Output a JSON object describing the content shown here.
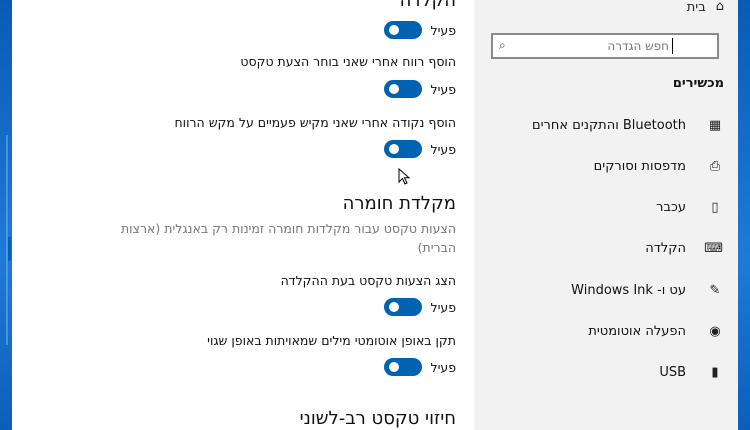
{
  "sidebar": {
    "home_label": "בית",
    "search_placeholder": "חפש הגדרה",
    "category": "מכשירים",
    "items": [
      {
        "label": "Bluetooth והתקנים אחרים",
        "icon": "bluetooth-devices-icon"
      },
      {
        "label": "מדפסות וסורקים",
        "icon": "printer-icon"
      },
      {
        "label": "עכבר",
        "icon": "mouse-icon"
      },
      {
        "label": "הקלדה",
        "icon": "keyboard-icon",
        "selected": true
      },
      {
        "label": "עט ו- Windows Ink",
        "icon": "pen-icon"
      },
      {
        "label": "הפעלה אוטומטית",
        "icon": "autoplay-icon"
      },
      {
        "label": "USB",
        "icon": "usb-icon"
      }
    ]
  },
  "main": {
    "section_typing_heading": "הקלדה",
    "toggle_on_label": "פעיל",
    "space_after_suggestion_label": "הוסף רווח אחרי שאני בוחר הצעת טקסט",
    "period_after_double_space_label": "הוסף נקודה אחרי שאני מקיש פעמיים על מקש הרווח",
    "hardware_keyboard_heading": "מקלדת חומרה",
    "hardware_keyboard_desc": "הצעות טקסט עבור מקלדות חומרה זמינות רק באנגלית (ארצות הברית)",
    "show_suggestions_label": "הצג הצעות טקסט בעת ההקלדה",
    "autocorrect_label": "תקן באופן אוטומטי מילים שמאויתות באופן שגוי",
    "multilingual_heading": "חיזוי טקסט רב-לשוני"
  },
  "colors": {
    "accent": "#0063b1",
    "sidebar_bg": "#f2f2f2"
  }
}
